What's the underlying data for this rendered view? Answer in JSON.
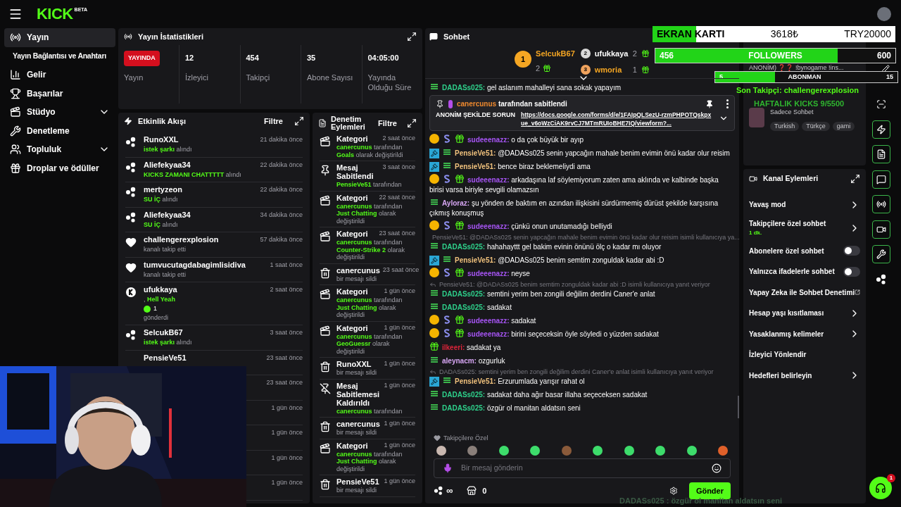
{
  "topbar": {
    "logo": "KICK",
    "logo_badge": "BETA"
  },
  "sidebar": {
    "items": [
      {
        "kind": "stream",
        "label": "Yayın",
        "selected": true,
        "expandable": false
      },
      {
        "kind": "sub",
        "label": "Yayın Bağlantısı ve Anahtarı",
        "selected": false,
        "expandable": false
      },
      {
        "kind": "revenue",
        "label": "Gelir",
        "selected": false,
        "expandable": false
      },
      {
        "kind": "trophy",
        "label": "Başarılar",
        "selected": false,
        "expandable": false
      },
      {
        "kind": "studio",
        "label": "Stüdyo",
        "selected": false,
        "expandable": true
      },
      {
        "kind": "wrench",
        "label": "Denetleme",
        "selected": false,
        "expandable": false
      },
      {
        "kind": "community",
        "label": "Topluluk",
        "selected": false,
        "expandable": true
      },
      {
        "kind": "drops",
        "label": "Droplar ve ödüller",
        "selected": false,
        "expandable": false
      }
    ]
  },
  "stats": {
    "title": "Yayın İstatistikleri",
    "status": "YAYINDA",
    "status_label": "Yayın",
    "items": [
      {
        "value": "12",
        "label": "İzleyici"
      },
      {
        "value": "454",
        "label": "Takipçi"
      },
      {
        "value": "35",
        "label": "Abone Sayısı"
      },
      {
        "value": "04:05:00",
        "label": "Yayında Olduğu Süre"
      }
    ]
  },
  "activity": {
    "title": "Etkinlik Akışı",
    "filter": "Filtre",
    "items": [
      {
        "kind": "kicks",
        "user": "RunoXXL",
        "time": "21 dakika önce",
        "detail": "**istek şarkı** alındı"
      },
      {
        "kind": "kicks",
        "user": "Aliefekyaa34",
        "time": "22 dakika önce",
        "detail": "**KICKS ZAMANI CHATTTTT** alındı"
      },
      {
        "kind": "kicks",
        "user": "mertyzeon",
        "time": "22 dakika önce",
        "detail": "**SU İÇ** alındı"
      },
      {
        "kind": "kicks",
        "user": "Aliefekyaa34",
        "time": "34 dakika önce",
        "detail": "**SU İÇ** alındı"
      },
      {
        "kind": "follow",
        "user": "challengerexplosion",
        "time": "57 dakika önce",
        "detail": "kanalı takip etti"
      },
      {
        "kind": "follow",
        "user": "tumvucutagdabagimlisidiva",
        "time": "1 saat önce",
        "detail": "kanalı takip etti"
      },
      {
        "kind": "gift",
        "user": "ufukkaya",
        "time": "2 saat önce",
        "detail": ", **Hell Yeah**",
        "amount": "1",
        "after": "gönderdi"
      },
      {
        "kind": "kicks",
        "user": "SelcukB67",
        "time": "3 saat önce",
        "detail": "**istek şarkı** alındı"
      },
      {
        "user": "PensieVe51",
        "time": "23 saat önce"
      },
      {
        "time": "23 saat önce"
      },
      {
        "time": "1 gün önce"
      },
      {
        "time": "1 gün önce"
      },
      {
        "time": "1 gün önce"
      },
      {
        "time": "1 gün önce"
      }
    ]
  },
  "moderation": {
    "title": "Denetim Eylemleri",
    "filter": "Filtre",
    "items": [
      {
        "kind": "category",
        "title": "Kategori",
        "time": "2 saat önce",
        "detail": "**canercunus** tarafından **Goals** olarak değiştirildi"
      },
      {
        "kind": "pin",
        "title": "Mesaj Sabitlendi",
        "time": "3 saat önce",
        "detail": "**PensieVe51** tarafından"
      },
      {
        "kind": "category",
        "title": "Kategori",
        "time": "22 saat önce",
        "detail": "**canercunus** tarafından **Just Chatting** olarak değiştirildi"
      },
      {
        "kind": "category",
        "title": "Kategori",
        "time": "23 saat önce",
        "detail": "**canercunus** tarafından **Counter-Strike 2** olarak değiştirildi"
      },
      {
        "kind": "delete",
        "title": "canercunus",
        "time": "23 saat önce",
        "detail": "bir mesajı sildi"
      },
      {
        "kind": "category",
        "title": "Kategori",
        "time": "1 gün önce",
        "detail": "**canercunus** tarafından **Just Chatting** olarak değiştirildi"
      },
      {
        "kind": "category",
        "title": "Kategori",
        "time": "1 gün önce",
        "detail": "**canercunus** tarafından **GeoGuessr** olarak değiştirildi"
      },
      {
        "kind": "delete",
        "title": "RunoXXL",
        "time": "1 gün önce",
        "detail": "bir mesajı sildi"
      },
      {
        "kind": "unpin",
        "title": "Mesaj Sabitlemesi Kaldırıldı",
        "time": "1 gün önce",
        "detail": "**canercunus** tarafından"
      },
      {
        "kind": "delete",
        "title": "canercunus",
        "time": "1 gün önce",
        "detail": "bir mesajı sildi"
      },
      {
        "kind": "category",
        "title": "Kategori",
        "time": "1 gün önce",
        "detail": "**canercunus** tarafından **Just Chatting** olarak değiştirildi"
      },
      {
        "kind": "delete",
        "title": "PensieVe51",
        "time": "1 gün önce",
        "detail": "bir mesajı sildi"
      }
    ]
  },
  "chat": {
    "title": "Sohbet",
    "leaders": [
      {
        "rank": "1",
        "user": "SelcukB67",
        "count": "2",
        "color": "#f5a623"
      },
      {
        "rank": "2",
        "user": "ufukkaya",
        "count": "2",
        "color": "#d9d9d9"
      },
      {
        "rank": "3",
        "user": "wmoria",
        "count": "1",
        "color": "#f0a35e"
      }
    ],
    "pinned": {
      "user": "canercunus",
      "note": "tarafından sabitlendi",
      "text": "ANONİM ŞEKİLDE SORUN",
      "link": "https://docs.google.com/forms/d/e/1FAIpQLSezU-rzmPHPOTQskpxue_v6oWzCiAK9rvCJ7MTmRUIoBHE7IQ/viewform?..."
    },
    "messages": [
      {
        "kind": "message",
        "badges": [
          {
            "kind": "og"
          }
        ],
        "user": "DADASs025:",
        "color": "#2ed18b",
        "text": "gel aslanım mahalleyi sana sokak yapayım"
      },
      {
        "kind": "message",
        "badges": [
          {
            "kind": "gifter"
          },
          {
            "kind": "sub"
          },
          {
            "kind": "gift"
          }
        ],
        "user": "sudeeenazz:",
        "color": "#a855f7",
        "text": "o da çok büyük bir ayıp"
      },
      {
        "kind": "message",
        "badges": [
          {
            "kind": "mod"
          },
          {
            "kind": "og"
          }
        ],
        "user": "PensieVe51:",
        "color": "#f1c27d",
        "text": "@DADASs025 senin yapcağın mahale benim evimin önü kadar olur reisim"
      },
      {
        "kind": "message",
        "badges": [
          {
            "kind": "mod"
          },
          {
            "kind": "og"
          }
        ],
        "user": "PensieVe51:",
        "color": "#f1c27d",
        "text": "bence biraz beklemeliydi ama"
      },
      {
        "kind": "message",
        "badges": [
          {
            "kind": "gifter"
          },
          {
            "kind": "sub"
          },
          {
            "kind": "gift"
          }
        ],
        "user": "sudeeenazz:",
        "color": "#a855f7",
        "text": "arkadaşına laf söylemiyorum zaten ama aklında ve kalbinde başka birisi varsa biriyle sevgili olamazsın"
      },
      {
        "kind": "message",
        "badges": [
          {
            "kind": "og"
          }
        ],
        "user": "Ayloraz:",
        "color": "#d8a7f5",
        "text": "şu yönden de baktım en azından ilişkisini sürdürmemiş dürüst şekilde karşısına çıkmış konuşmuş"
      },
      {
        "kind": "message",
        "badges": [
          {
            "kind": "gifter"
          },
          {
            "kind": "sub"
          },
          {
            "kind": "gift"
          }
        ],
        "user": "sudeeenazz:",
        "color": "#a855f7",
        "text": "çünkü onun unutamadığı belliydi"
      },
      {
        "kind": "reply",
        "text": "PensieVe51: @DADASs025 senin yapcağın mahale benim evimin önü kadar olur reisim isimli kullanıcıya ya..."
      },
      {
        "kind": "message",
        "badges": [
          {
            "kind": "og"
          }
        ],
        "user": "DADASs025:",
        "color": "#2ed18b",
        "text": "hahahayttt gel bakim evinin önünü ölç o kadar mı oluyor"
      },
      {
        "kind": "message",
        "badges": [
          {
            "kind": "mod"
          },
          {
            "kind": "og"
          }
        ],
        "user": "PensieVe51:",
        "color": "#f1c27d",
        "text": "@DADASs025 benim semtim zonguldak kadar abi :D"
      },
      {
        "kind": "message",
        "badges": [
          {
            "kind": "gifter"
          },
          {
            "kind": "sub"
          },
          {
            "kind": "gift"
          }
        ],
        "user": "sudeeenazz:",
        "color": "#a855f7",
        "text": "neyse"
      },
      {
        "kind": "reply",
        "text": "PensieVe51: @DADASs025 benim semtim zonguldak kadar abi :D isimli kullanıcıya yanıt veriyor"
      },
      {
        "kind": "message",
        "badges": [
          {
            "kind": "og"
          }
        ],
        "user": "DADASs025:",
        "color": "#2ed18b",
        "text": "semtini yerim ben zongili değilim derdini Caner'e anlat"
      },
      {
        "kind": "message",
        "badges": [
          {
            "kind": "og"
          }
        ],
        "user": "DADASs025:",
        "color": "#2ed18b",
        "text": "sadakat"
      },
      {
        "kind": "message",
        "badges": [
          {
            "kind": "gifter"
          },
          {
            "kind": "sub"
          },
          {
            "kind": "gift"
          }
        ],
        "user": "sudeeenazz:",
        "color": "#a855f7",
        "text": "sadakat"
      },
      {
        "kind": "message",
        "badges": [
          {
            "kind": "gifter"
          },
          {
            "kind": "sub"
          },
          {
            "kind": "gift"
          }
        ],
        "user": "sudeeenazz:",
        "color": "#a855f7",
        "text": "birini seçeceksin öyle söyledi o yüzden sadakat"
      },
      {
        "kind": "message",
        "badges": [
          {
            "kind": "gift"
          }
        ],
        "user": "ilkeeri:",
        "color": "#e0243a",
        "text": "sadakat ya"
      },
      {
        "kind": "message",
        "badges": [
          {
            "kind": "og"
          }
        ],
        "user": "aleynacm:",
        "color": "#d8a7f5",
        "text": "ozgurluk"
      },
      {
        "kind": "reply",
        "text": "DADASs025: semtini yerim ben zongili değilim derdini Caner'e anlat isimli kullanıcıya yanıt veriyor"
      },
      {
        "kind": "message",
        "badges": [
          {
            "kind": "mod"
          },
          {
            "kind": "og"
          }
        ],
        "user": "PensieVe51:",
        "color": "#f1c27d",
        "text": "Erzurumlada yarışır rahat ol"
      },
      {
        "kind": "message",
        "badges": [
          {
            "kind": "og"
          }
        ],
        "user": "DADASs025:",
        "color": "#2ed18b",
        "text": "sadakat daha ağır basar illaha seçeceksen sadakat"
      },
      {
        "kind": "message",
        "badges": [
          {
            "kind": "og"
          }
        ],
        "user": "DADASs025:",
        "color": "#2ed18b",
        "text": "özgür ol manitan aldatsın seni"
      }
    ],
    "emote_section": "Takipçilere Özel",
    "emotes": [
      {
        "color": "#c9b8b0"
      },
      {
        "color": "#8a7f7a"
      },
      {
        "color": "#3ddc6b"
      },
      {
        "color": "#3ddc6b"
      },
      {
        "color": "#8a5a3a"
      },
      {
        "color": "#3ddc6b"
      },
      {
        "color": "#3ddc6b"
      },
      {
        "color": "#3ddc6b"
      },
      {
        "color": "#3ddc6b"
      },
      {
        "color": "#e0602a"
      }
    ],
    "input_placeholder": "Bir mesaj gönderin",
    "kicks_balance": "∞",
    "store_count": "0",
    "send": "Gönder"
  },
  "preview": {
    "title": "ANONİM) ❓❓ !bynogame !ins...",
    "category": "Sadece Sohbet",
    "tags": [
      "Turkish",
      "Türkçe",
      "gami"
    ]
  },
  "channel_actions": {
    "title": "Kanal Eylemleri",
    "items": [
      {
        "kind": "chevron",
        "label": "Yavaş mod"
      },
      {
        "kind": "chevron",
        "label": "Takipçilere özel sohbet",
        "sub": "1 dk."
      },
      {
        "kind": "toggle",
        "label": "Abonelere özel sohbet",
        "on": false
      },
      {
        "kind": "toggle",
        "label": "Yalnızca ifadelerle sohbet",
        "on": false
      },
      {
        "kind": "external",
        "label": "Yapay Zeka ile Sohbet Denetimi"
      },
      {
        "kind": "chevron",
        "label": "Hesap yaşı kısıtlaması"
      },
      {
        "kind": "chevron",
        "label": "Yasaklanmış kelimeler"
      },
      {
        "kind": "plain",
        "label": "İzleyici Yönlendir"
      },
      {
        "kind": "chevron",
        "label": "Hedefleri belirleyin"
      }
    ]
  },
  "rail": [
    {
      "kind": "capture",
      "boxed": false
    },
    {
      "kind": "zap",
      "boxed": true
    },
    {
      "kind": "doc",
      "boxed": true
    },
    {
      "kind": "chat",
      "boxed": true
    },
    {
      "kind": "broadcast",
      "boxed": true
    },
    {
      "kind": "video",
      "boxed": true
    },
    {
      "kind": "wrench",
      "boxed": true
    },
    {
      "kind": "kicks",
      "boxed": false
    }
  ],
  "support_badge": "1",
  "overlay": {
    "goal": {
      "label": "EKRAN KARTI",
      "amount": "3618₺",
      "target": "TRY20000",
      "level": 0.18
    },
    "followers": {
      "current": "456",
      "label": "FOLLOWERS",
      "target": "600",
      "level": 0.76
    },
    "subs": {
      "current": "5",
      "label": "ABONMAN",
      "target": "15",
      "level": 0.33
    },
    "last_follower": "Son Takipçi: challengerexplosion",
    "weekly": "HAFTALIK KICKS 9/5500",
    "ticker_user": "DADASs025",
    "ticker_text": ": özgür ol manitan aldatsın seni"
  }
}
